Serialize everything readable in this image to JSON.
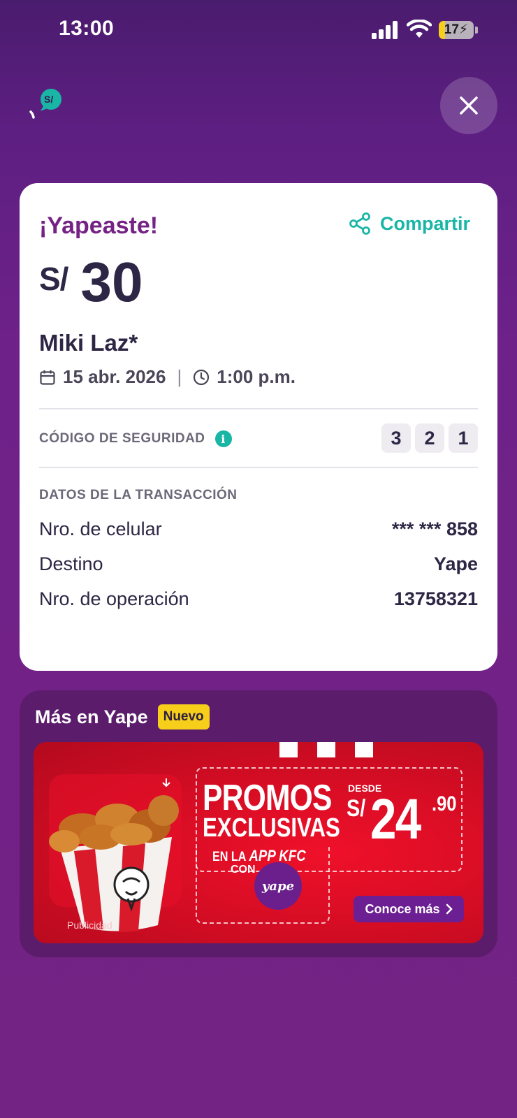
{
  "status_bar": {
    "time": "13:00",
    "battery": "17",
    "battery_fill": 0.17
  },
  "header": {
    "logo_text": "S/",
    "close_icon": "close-icon"
  },
  "receipt": {
    "title": "¡Yapeaste!",
    "share_label": "Compartir",
    "currency": "S/",
    "amount": "30",
    "recipient": "Miki Laz*",
    "date": "15 abr. 2026",
    "time": "1:00 p.m.",
    "security_label": "CÓDIGO DE SEGURIDAD",
    "security_code": [
      "3",
      "2",
      "1"
    ],
    "transaction_title": "DATOS DE LA TRANSACCIÓN",
    "rows": [
      {
        "label": "Nro. de celular",
        "value": "*** *** 858"
      },
      {
        "label": "Destino",
        "value": "Yape"
      },
      {
        "label": "Nro. de operación",
        "value": "13758321"
      }
    ]
  },
  "promo": {
    "section_title": "Más en Yape",
    "badge": "Nuevo",
    "headline_1": "PROMOS",
    "headline_2": "EXCLUSIVAS",
    "desde": "DESDE",
    "price_currency": "S/",
    "price_main": "24",
    "price_cents": ".90",
    "app_line_prefix": "EN LA ",
    "app_line_brand": "APP KFC",
    "con": "CON",
    "yape_badge_text": "yape",
    "cta_label": "Conoce más",
    "disclaimer": "Publicidad"
  },
  "colors": {
    "background": "#6d2189",
    "accent_purple": "#742284",
    "accent_teal": "#19b6a6",
    "badge_yellow": "#f7ce1a",
    "promo_red": "#d60d24"
  }
}
